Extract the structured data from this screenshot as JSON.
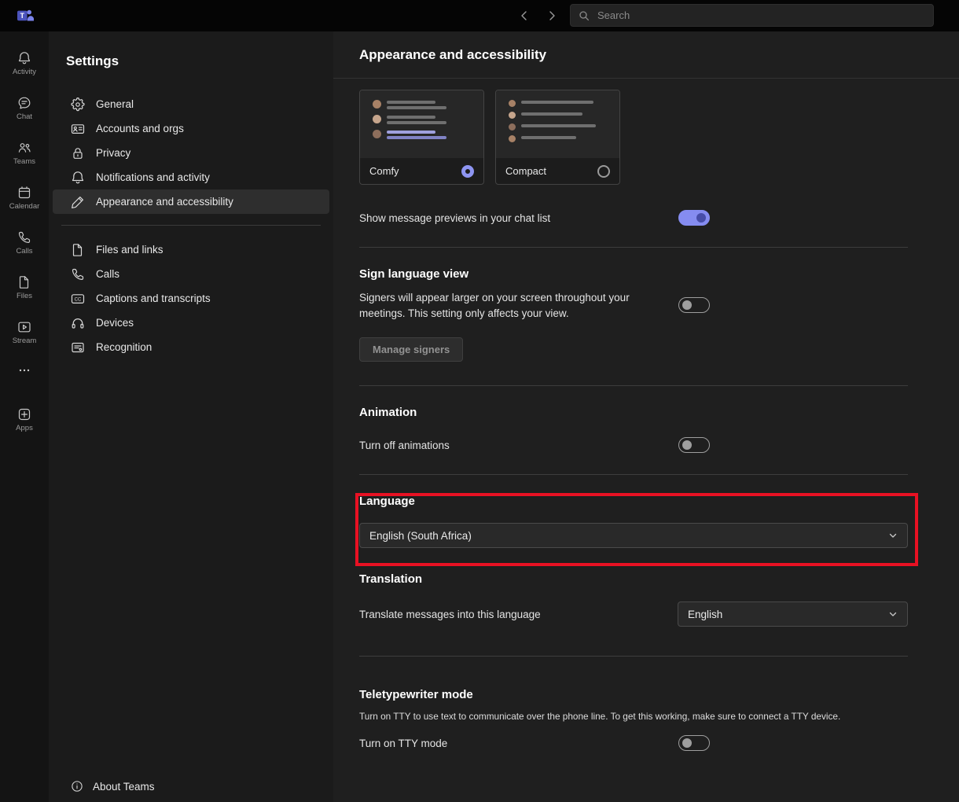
{
  "topbar": {
    "search_placeholder": "Search"
  },
  "rail": {
    "items": [
      {
        "label": "Activity"
      },
      {
        "label": "Chat"
      },
      {
        "label": "Teams"
      },
      {
        "label": "Calendar"
      },
      {
        "label": "Calls"
      },
      {
        "label": "Files"
      },
      {
        "label": "Stream"
      },
      {
        "label": ""
      },
      {
        "label": "Apps"
      }
    ]
  },
  "sidebar": {
    "title": "Settings",
    "group1": [
      {
        "label": "General",
        "selected": false
      },
      {
        "label": "Accounts and orgs",
        "selected": false
      },
      {
        "label": "Privacy",
        "selected": false
      },
      {
        "label": "Notifications and activity",
        "selected": false
      },
      {
        "label": "Appearance and accessibility",
        "selected": true
      }
    ],
    "group2": [
      {
        "label": "Files and links",
        "selected": false
      },
      {
        "label": "Calls",
        "selected": false
      },
      {
        "label": "Captions and transcripts",
        "selected": false
      },
      {
        "label": "Devices",
        "selected": false
      },
      {
        "label": "Recognition",
        "selected": false
      }
    ],
    "about": "About Teams"
  },
  "main": {
    "title": "Appearance and accessibility",
    "themes": [
      {
        "label": "Comfy",
        "selected": true
      },
      {
        "label": "Compact",
        "selected": false
      }
    ],
    "message_preview": {
      "label": "Show message previews in your chat list",
      "on": true
    },
    "sign_language": {
      "heading": "Sign language view",
      "description": "Signers will appear larger on your screen throughout your meetings. This setting only affects your view.",
      "on": false,
      "button_label": "Manage signers"
    },
    "animation": {
      "heading": "Animation",
      "label": "Turn off animations",
      "on": false
    },
    "language": {
      "heading": "Language",
      "selected": "English (South Africa)"
    },
    "translation": {
      "heading": "Translation",
      "label": "Translate messages into this language",
      "selected": "English"
    },
    "tty": {
      "heading": "Teletypewriter mode",
      "description": "Turn on TTY to use text to communicate over the phone line. To get this working, make sure to connect a TTY device.",
      "label": "Turn on TTY mode",
      "on": false
    }
  },
  "colors": {
    "accent": "#858cf0",
    "annotation_red": "#e81123"
  }
}
